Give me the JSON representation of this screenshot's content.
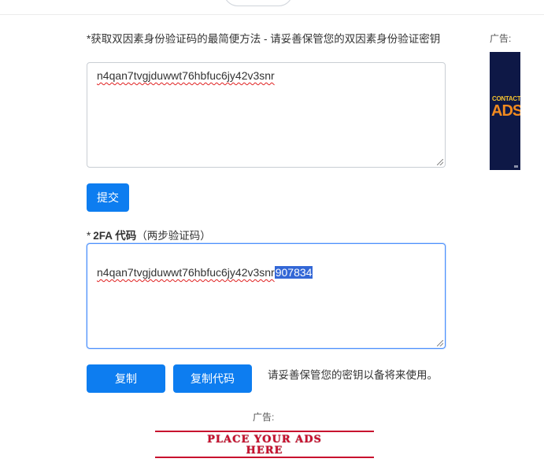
{
  "form": {
    "secret_label": "*获取双因素身份验证码的最简便方法 - 请妥善保管您的双因素身份验证密钥",
    "secret_value": "n4qan7tvgjduwwt76hbfuc6jy42v3snr",
    "submit_label": "提交",
    "code_label_star": "*",
    "code_label_main": "2FA 代码",
    "code_label_sub": "（两步验证码）",
    "code_value_prefix": "n4qan7tvgjduwwt76hbfuc6jy42v3snr",
    "code_value_selected": "907834",
    "copy_label": "复制",
    "copy_code_label": "复制代码",
    "copy_hint": "请妥善保管您的密钥以备将来使用。"
  },
  "ads": {
    "label_right": "广告:",
    "label_bottom": "广告:",
    "side_line1": "CONTACT",
    "side_line2": "ADS",
    "banner_line1": "PLACE YOUR ADS",
    "banner_line2": "HERE"
  },
  "colors": {
    "primary": "#0d7df0",
    "selection": "#3367d6",
    "banner_red": "#c8102e",
    "side_ad_bg": "#0e1846"
  }
}
